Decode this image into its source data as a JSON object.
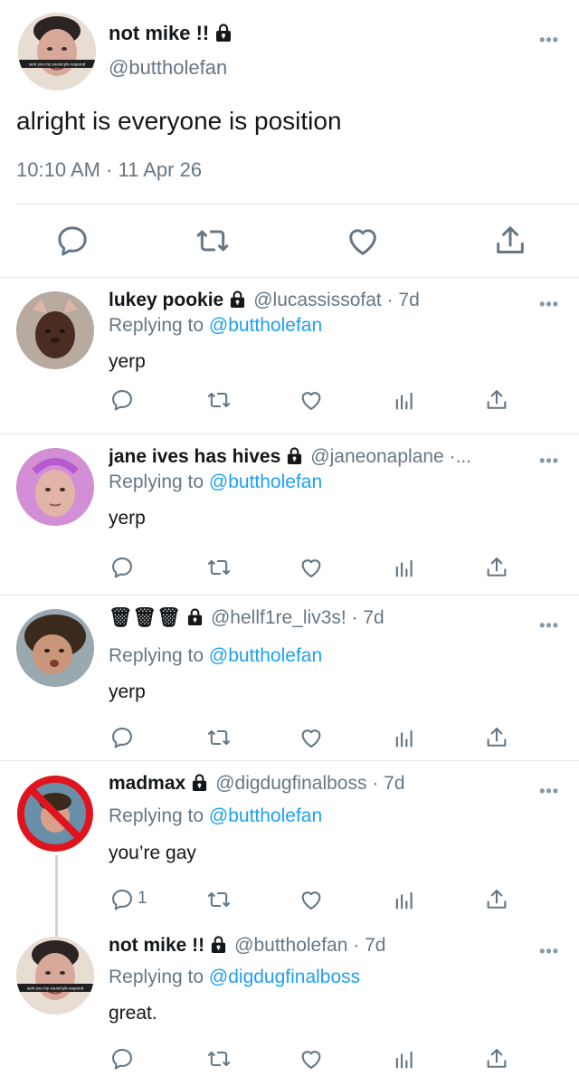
{
  "main_tweet": {
    "avatar_caption": "sent you my sound pls respond",
    "name": "not mike !!",
    "handle": "@buttholefan",
    "text": "alright is everyone is position",
    "timestamp": "10:10 AM · 11 Apr 26",
    "more": "•••"
  },
  "replies": [
    {
      "name": "lukey pookie",
      "handle": "@lucassissofat · 7d",
      "replying_prefix": "Replying to ",
      "replying_to": "@buttholefan",
      "text": "yerp",
      "reply_count": "",
      "more": "•••"
    },
    {
      "name": "jane ives has hives",
      "handle": "@janeonaplane ·...",
      "replying_prefix": "Replying to ",
      "replying_to": "@buttholefan",
      "text": "yerp",
      "reply_count": "",
      "more": "•••"
    },
    {
      "name": "🗑🗑🗑",
      "handle": "@hellf1re_liv3s! · 7d",
      "replying_prefix": "Replying to ",
      "replying_to": "@buttholefan",
      "text": "yerp",
      "reply_count": "",
      "more": "•••"
    },
    {
      "name": "madmax",
      "handle": "@digdugfinalboss · 7d",
      "replying_prefix": "Replying to ",
      "replying_to": "@buttholefan",
      "text": "you’re gay",
      "reply_count": "1",
      "more": "•••"
    },
    {
      "name": "not mike !!",
      "avatar_caption": "sent you my sound pls respond",
      "handle": "@buttholefan · 7d",
      "replying_prefix": "Replying to ",
      "replying_to": "@digdugfinalboss",
      "text": "great.",
      "reply_count": "",
      "more": "•••"
    }
  ],
  "icons": [
    "reply-icon",
    "retweet-icon",
    "like-icon",
    "analytics-icon",
    "share-icon",
    "lock-icon",
    "more-icon"
  ],
  "colors": {
    "link": "#1da1f2",
    "secondary": "#657786",
    "primary": "#14171a",
    "divider": "#e1e8ed"
  }
}
